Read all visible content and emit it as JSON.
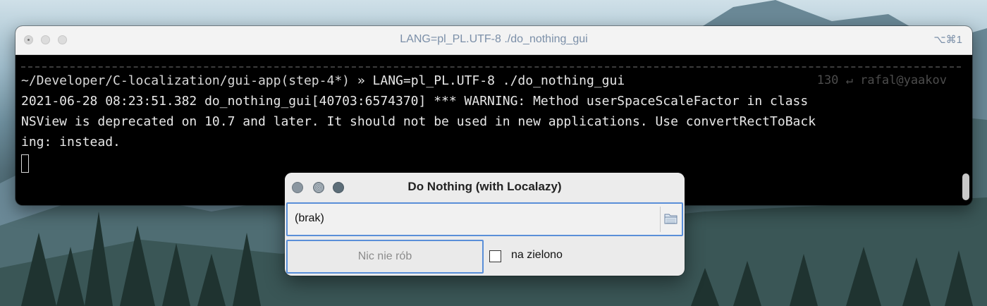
{
  "terminal": {
    "title": "LANG=pl_PL.UTF-8 ./do_nothing_gui",
    "shortcut": "⌥⌘1",
    "prompt_path": "~/Developer/C-localization/gui-app(step-4*)",
    "prompt_symbol": "»",
    "command": "LANG=pl_PL.UTF-8 ./do_nothing_gui",
    "exit_code": "130",
    "return_glyph": "↵",
    "user_host": "rafal@yaakov",
    "output_lines": [
      "2021-06-28 08:23:51.382 do_nothing_gui[40703:6574370] *** WARNING: Method userSpaceScaleFactor in class",
      "NSView is deprecated on 10.7 and later. It should not be used in new applications. Use convertRectToBack",
      "ing: instead."
    ]
  },
  "dialog": {
    "title": "Do Nothing (with Localazy)",
    "path_value": "(brak)",
    "folder_icon": "folder-icon",
    "button_label": "Nic nie rób",
    "checkbox_label": "na zielono",
    "checkbox_checked": false
  },
  "colors": {
    "terminal_bg": "#000000",
    "accent_focus": "#5a8fd8",
    "title_text": "#7b8fa8"
  }
}
